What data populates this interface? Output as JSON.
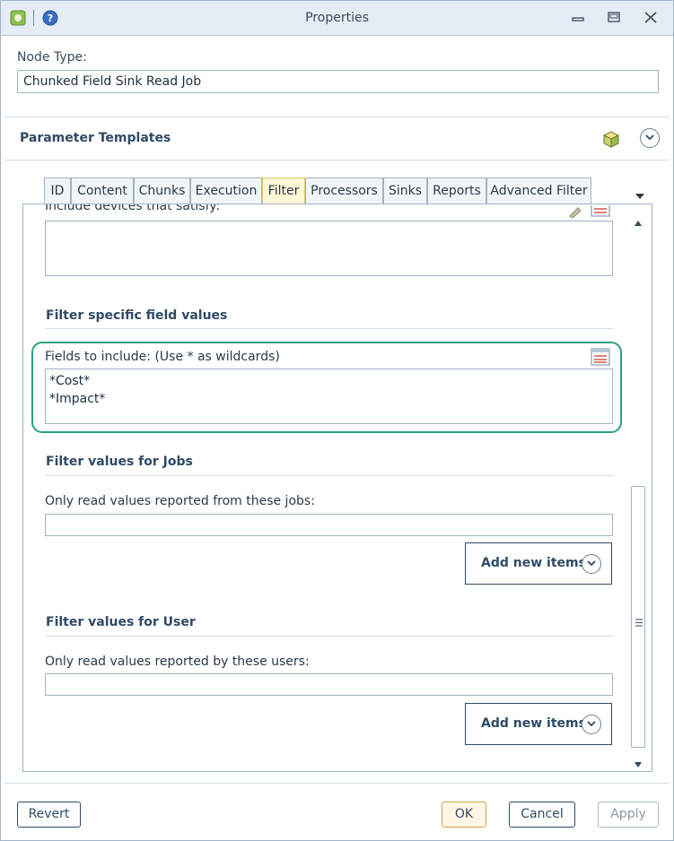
{
  "window": {
    "title": "Properties"
  },
  "node_type": {
    "label": "Node Type:",
    "value": "Chunked Field Sink Read Job"
  },
  "parameter_templates": {
    "title": "Parameter Templates"
  },
  "tabs": [
    {
      "label": "ID"
    },
    {
      "label": "Content"
    },
    {
      "label": "Chunks"
    },
    {
      "label": "Execution"
    },
    {
      "label": "Filter",
      "active": true
    },
    {
      "label": "Processors"
    },
    {
      "label": "Sinks"
    },
    {
      "label": "Reports"
    },
    {
      "label": "Advanced Filter"
    }
  ],
  "filter": {
    "devices_label": "Include devices that satisfy:",
    "devices_value": "",
    "field_values": {
      "heading": "Filter specific field values",
      "fields_label": "Fields to include: (Use * as wildcards)",
      "fields_lines": [
        "*Cost*",
        "*Impact*"
      ]
    },
    "jobs": {
      "heading": "Filter values for Jobs",
      "label": "Only read values reported from these jobs:",
      "value": "",
      "add_label": "Add new items"
    },
    "user": {
      "heading": "Filter values for User",
      "label": "Only read values reported by these users:",
      "value": "",
      "add_label": "Add new items"
    }
  },
  "footer": {
    "revert": "Revert",
    "ok": "OK",
    "cancel": "Cancel",
    "apply": "Apply"
  },
  "colors": {
    "accent": "#2f4a66",
    "highlight": "#2aa085",
    "active_tab": "#fff7d6"
  },
  "icons": [
    "app-icon",
    "help-icon",
    "minimize-icon",
    "maximize-icon",
    "close-icon",
    "package-icon",
    "chevron-down-icon",
    "pencil-icon",
    "list-editor-icon",
    "tab-overflow-icon",
    "scroll-up-icon",
    "scroll-down-icon",
    "scroll-grip-icon"
  ]
}
